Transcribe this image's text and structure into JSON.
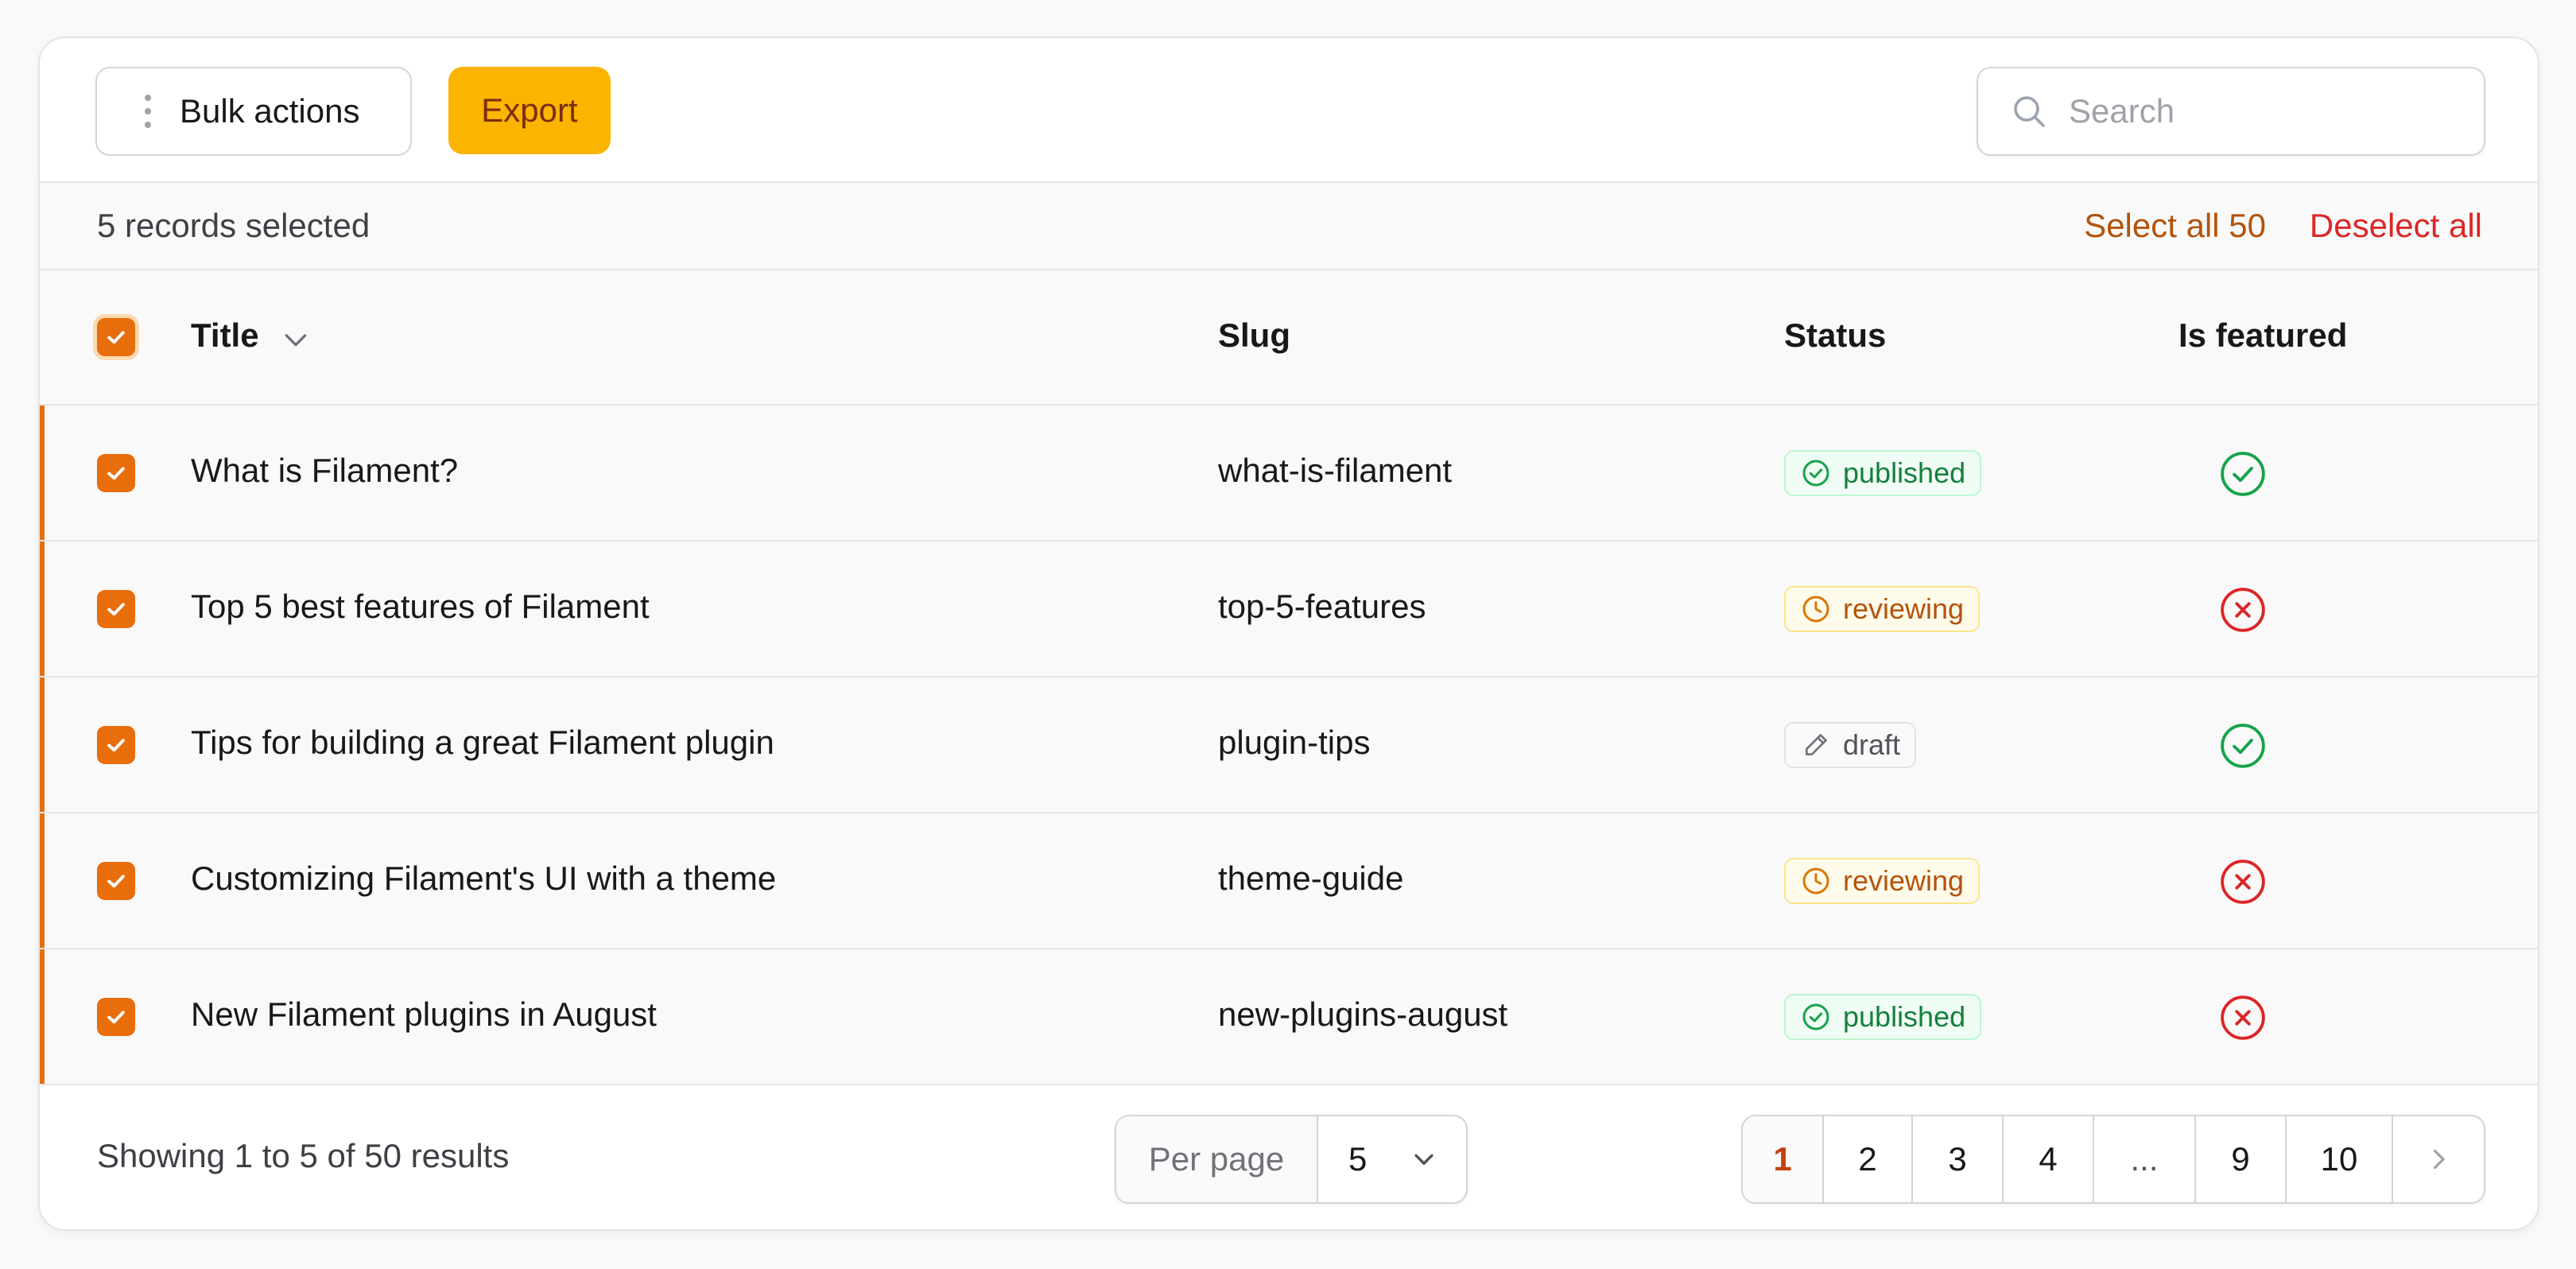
{
  "toolbar": {
    "bulk_actions_label": "Bulk actions",
    "export_label": "Export",
    "search_placeholder": "Search",
    "search_value": ""
  },
  "selection": {
    "count_text": "5 records selected",
    "select_all_label": "Select all 50",
    "deselect_all_label": "Deselect all"
  },
  "table": {
    "columns": [
      "Title",
      "Slug",
      "Status",
      "Is featured"
    ],
    "rows": [
      {
        "title": "What is Filament?",
        "slug": "what-is-filament",
        "status": "published",
        "featured": true,
        "selected": true
      },
      {
        "title": "Top 5 best features of Filament",
        "slug": "top-5-features",
        "status": "reviewing",
        "featured": false,
        "selected": true
      },
      {
        "title": "Tips for building a great Filament plugin",
        "slug": "plugin-tips",
        "status": "draft",
        "featured": true,
        "selected": true
      },
      {
        "title": "Customizing Filament's UI with a theme",
        "slug": "theme-guide",
        "status": "reviewing",
        "featured": false,
        "selected": true
      },
      {
        "title": "New Filament plugins in August",
        "slug": "new-plugins-august",
        "status": "published",
        "featured": false,
        "selected": true
      }
    ]
  },
  "footer": {
    "showing_text": "Showing 1 to 5 of 50 results",
    "per_page_label": "Per page",
    "per_page_value": "5",
    "pages": [
      "1",
      "2",
      "3",
      "4",
      "...",
      "9",
      "10"
    ],
    "current_page": "1"
  },
  "colors": {
    "primary": "#e86e0c",
    "export_button": "#fbb400",
    "success": "#16a34a",
    "warning": "#b45309",
    "danger": "#dc2626"
  },
  "icons": {
    "bulk_actions": "vertical-dots-icon",
    "search": "search-icon",
    "sort": "chevron-down-icon",
    "published": "check-circle-icon",
    "reviewing": "clock-icon",
    "draft": "pencil-icon",
    "featured_true": "check-circle-icon",
    "featured_false": "x-circle-icon",
    "next_page": "chevron-right-icon"
  }
}
